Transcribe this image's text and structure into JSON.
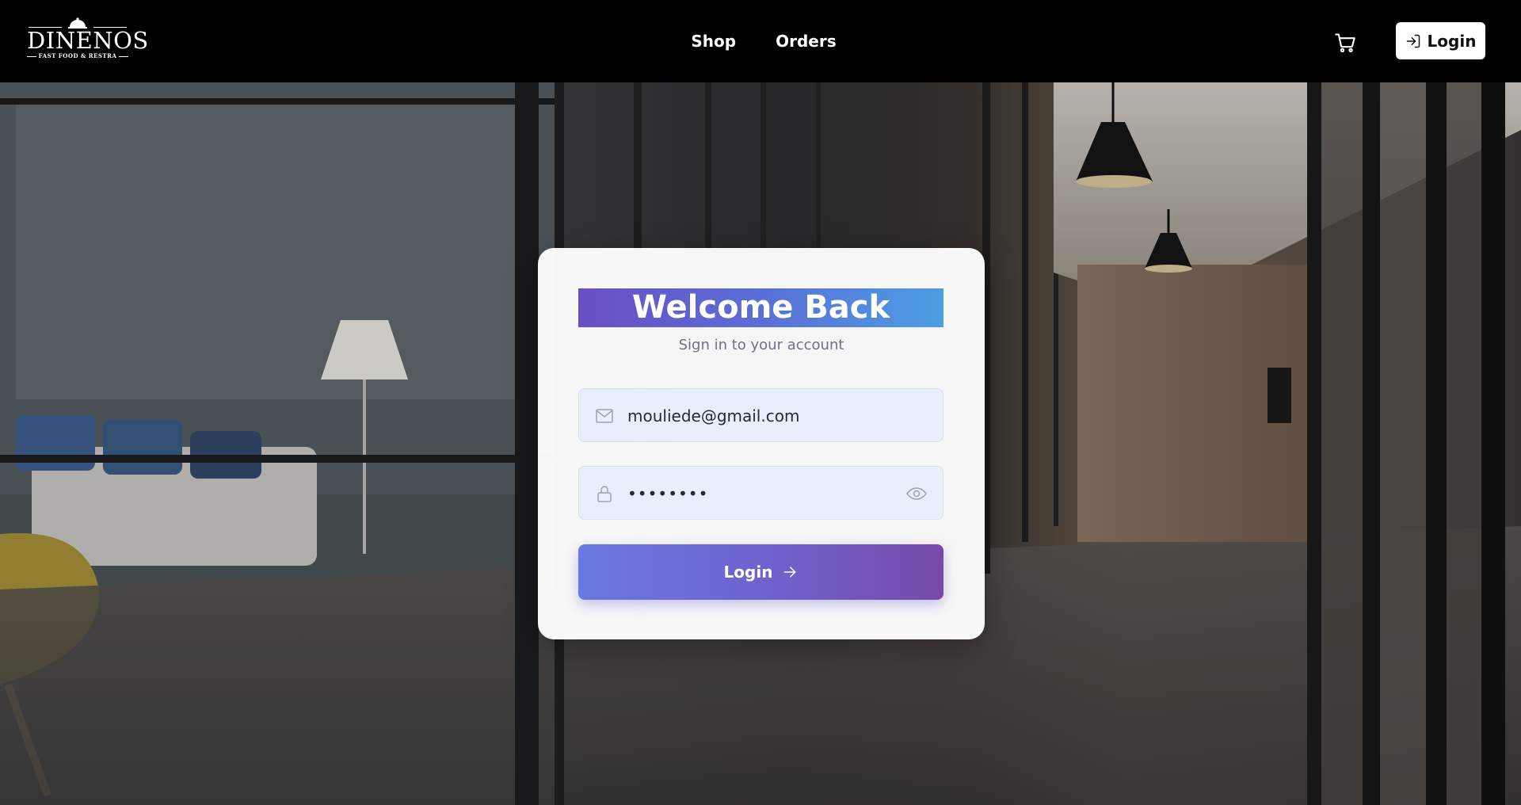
{
  "brand": {
    "name": "DINENOS",
    "tagline": "FAST FOOD & RESTRA"
  },
  "nav": {
    "links": [
      "Shop",
      "Orders"
    ],
    "cart_icon": "cart-icon",
    "login_label": "Login",
    "login_icon": "login-icon"
  },
  "login_card": {
    "title": "Welcome Back",
    "subtitle": "Sign in to your account",
    "email": {
      "value": "mouliede@gmail.com",
      "icon": "mail-icon"
    },
    "password": {
      "value": "••••••••",
      "icon": "lock-icon",
      "toggle_icon": "eye-icon"
    },
    "submit_label": "Login",
    "submit_icon": "arrow-right-icon"
  },
  "colors": {
    "title_gradient_start": "#6a4ec4",
    "title_gradient_end": "#4d9de3",
    "button_gradient_start": "#6a78e0",
    "button_gradient_end": "#774aa8",
    "input_bg": "#e8eefb"
  }
}
